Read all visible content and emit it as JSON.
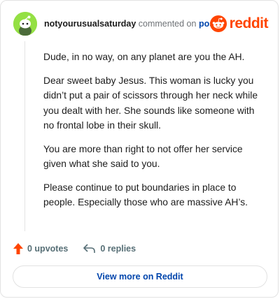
{
  "header": {
    "username": "notyourusualsaturday",
    "commented_text": "commented on",
    "post_link": "post",
    "brand": "reddit"
  },
  "comment": {
    "paragraphs": [
      "Dude, in no way, on any planet are you the AH.",
      "Dear sweet baby Jesus. This woman is lucky you didn’t put a pair of scissors through her neck while you dealt with her. She sounds like someone with no frontal lobe in their skull.",
      "You are more than right to not offer her service given what she said to you.",
      "Please continue to put boundaries in place to people. Especially those who are massive AH’s."
    ]
  },
  "actions": {
    "upvotes": "0 upvotes",
    "replies": "0 replies"
  },
  "footer": {
    "view_more": "View more on Reddit"
  },
  "colors": {
    "brand": "#ff4500",
    "link": "#0045ac",
    "avatar_bg": "#94e044"
  },
  "icons": [
    "avatar-snoo-icon",
    "reddit-logo-icon",
    "upvote-arrow-icon",
    "reply-arrow-icon"
  ]
}
